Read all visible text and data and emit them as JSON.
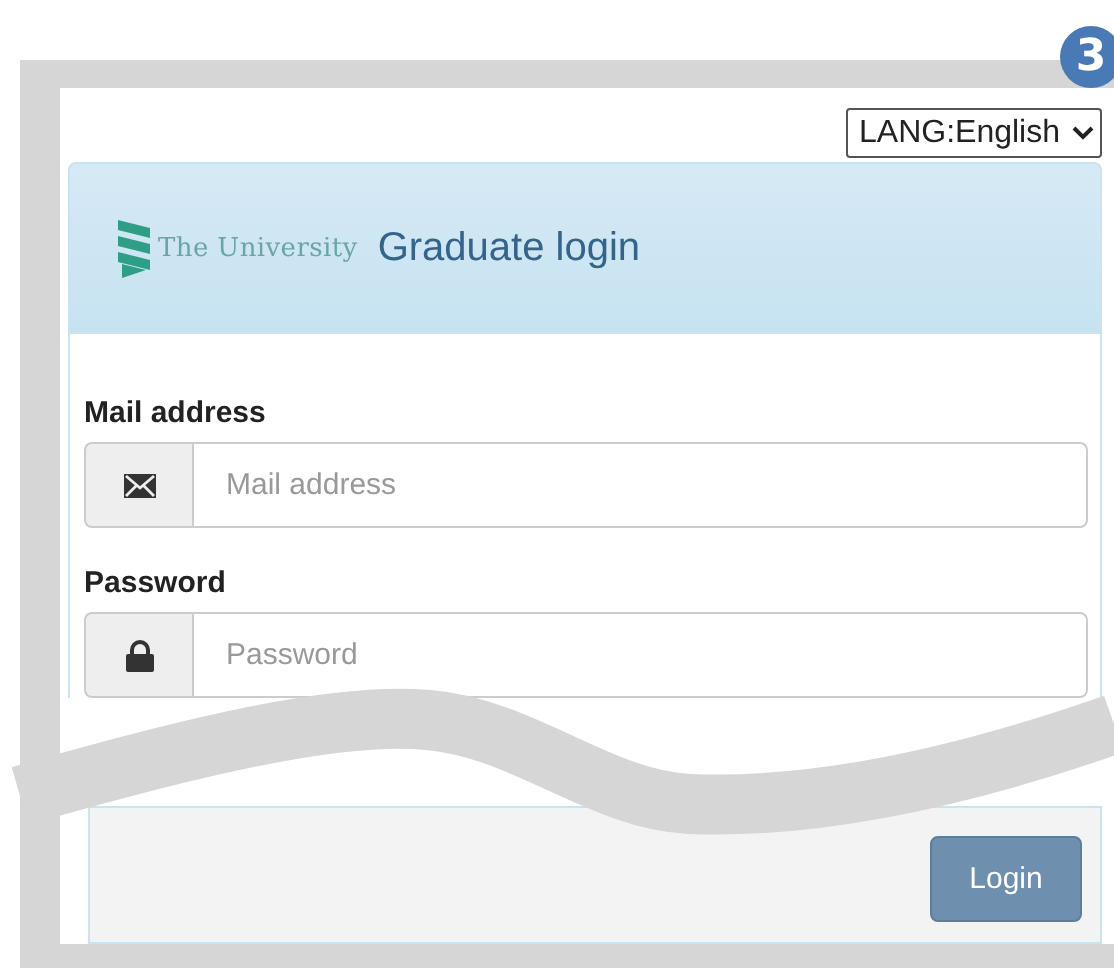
{
  "badge": "3",
  "language_select": {
    "value": "LANG:English"
  },
  "header": {
    "logo_text": "The University",
    "title": "Graduate login"
  },
  "fields": [
    {
      "kind": "email",
      "label": "Mail address",
      "placeholder": "Mail address"
    },
    {
      "kind": "password",
      "label": "Password",
      "placeholder": "Password"
    }
  ],
  "buttons": [
    {
      "label": "Login"
    }
  ]
}
